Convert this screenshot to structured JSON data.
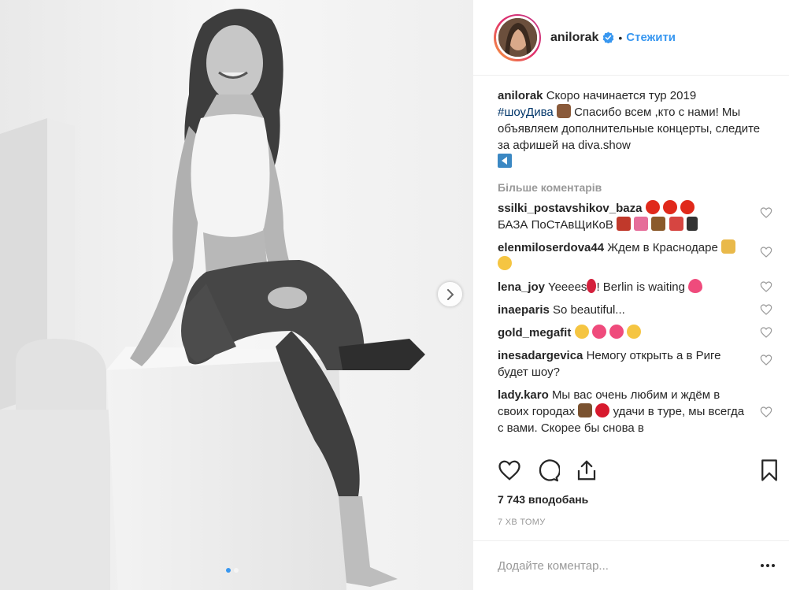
{
  "post": {
    "username": "anilorak",
    "follow_label": "Стежити",
    "header_separator": "•",
    "caption": {
      "username": "anilorak",
      "text_1": "Скоро начинается тур 2019",
      "hashtag": "#шоуДива",
      "text_2": "Спасибо всем ,кто с нами! Мы объявляем дополнительные концерты, следите за афишей на diva.show"
    },
    "load_more_label": "Більше коментарів",
    "comments": [
      {
        "username": "ssilki_postavshikov_baza",
        "text": "БАЗА  ПоСтАвЩиКоВ"
      },
      {
        "username": "elenmiloserdova44",
        "text": "Ждем в Краснодаре"
      },
      {
        "username": "lena_joy",
        "text_1": "Yeeees",
        "text_2": "! Berlin is waiting"
      },
      {
        "username": "inaeparis",
        "text": "So beautiful..."
      },
      {
        "username": "gold_megafit",
        "text": ""
      },
      {
        "username": "inesadargevica",
        "text": "Немогу открыть а в Риге будет шоу?"
      },
      {
        "username": "lady.karo",
        "text_1": "Мы вас очень любим и ждём в своих городах",
        "text_2": " удачи в туре, мы всегда с вами. Скорее бы снова в"
      }
    ],
    "likes_label": "7 743 вподобань",
    "time_label": "7 ХВ ТОМУ",
    "add_comment_placeholder": "Додайте коментар...",
    "carousel": {
      "total": 2,
      "current": 1
    }
  },
  "colors": {
    "accent": "#3897f0",
    "hashtag": "#003569",
    "muted": "#999999",
    "text": "#262626",
    "like_heart": "#ed4956"
  },
  "icons": [
    "chevron-right-icon",
    "verified-badge-icon",
    "heart-icon",
    "comment-icon",
    "share-icon",
    "bookmark-icon",
    "more-options-icon",
    "play-arrow-icon"
  ]
}
